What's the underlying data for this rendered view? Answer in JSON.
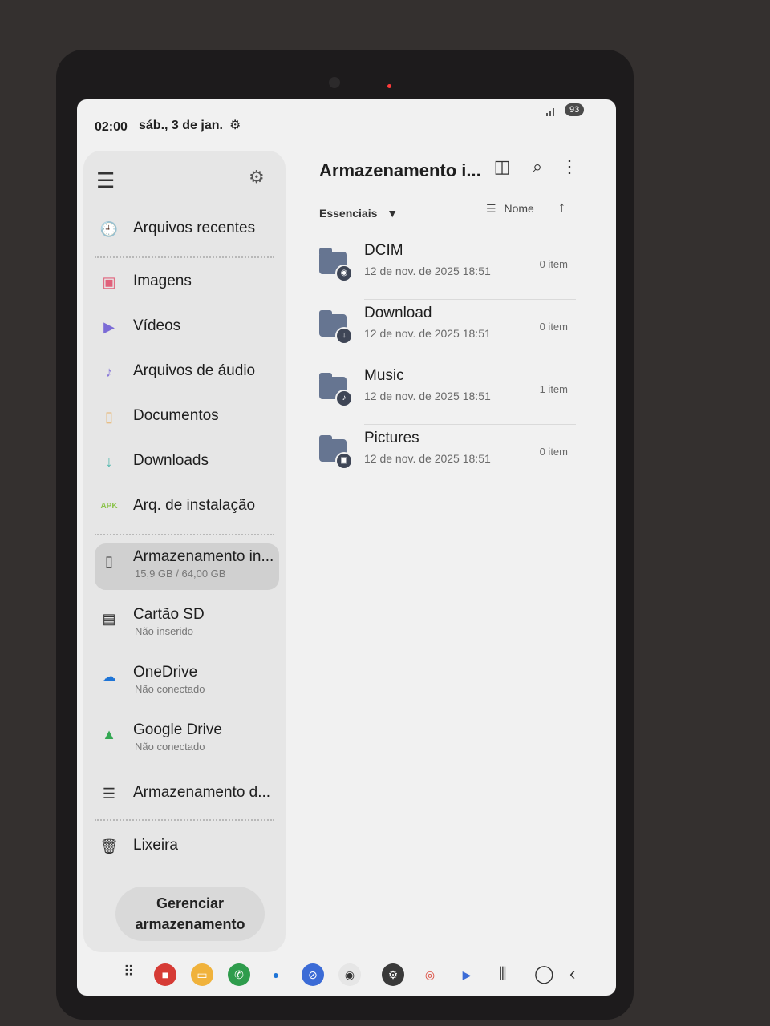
{
  "status_bar": {
    "time": "02:00",
    "date": "sáb., 3 de jan.",
    "battery": "93"
  },
  "sidebar": {
    "recent": "Arquivos recentes",
    "categories": [
      {
        "label": "Imagens",
        "icon": "image-icon"
      },
      {
        "label": "Vídeos",
        "icon": "video-icon"
      },
      {
        "label": "Arquivos de áudio",
        "icon": "audio-icon"
      },
      {
        "label": "Documentos",
        "icon": "document-icon"
      },
      {
        "label": "Downloads",
        "icon": "download-icon"
      },
      {
        "label": "Arq. de instalação",
        "icon": "apk-icon"
      }
    ],
    "apk_glyph": "APK",
    "storages": [
      {
        "label": "Armazenamento in...",
        "sub": "15,9 GB / 64,00 GB"
      },
      {
        "label": "Cartão SD",
        "sub": "Não inserido"
      },
      {
        "label": "OneDrive",
        "sub": "Não conectado"
      },
      {
        "label": "Google Drive",
        "sub": "Não conectado"
      },
      {
        "label": "Armazenamento d...",
        "sub": ""
      }
    ],
    "trash": "Lixeira",
    "manage_line1": "Gerenciar",
    "manage_line2": "armazenamento"
  },
  "main": {
    "title": "Armazenamento i...",
    "filter": "Essenciais",
    "sort_label": "Nome",
    "folders": [
      {
        "name": "DCIM",
        "date": "12 de nov. de 2025 18:51",
        "count": "0 item"
      },
      {
        "name": "Download",
        "date": "12 de nov. de 2025 18:51",
        "count": "0 item"
      },
      {
        "name": "Music",
        "date": "12 de nov. de 2025 18:51",
        "count": "1 item"
      },
      {
        "name": "Pictures",
        "date": "12 de nov. de 2025 18:51",
        "count": "0 item"
      }
    ]
  },
  "colors": {
    "folder": "#667591",
    "accent_video": "#7b6bd6",
    "accent_image": "#e0607a",
    "accent_apk": "#8bc34a"
  }
}
